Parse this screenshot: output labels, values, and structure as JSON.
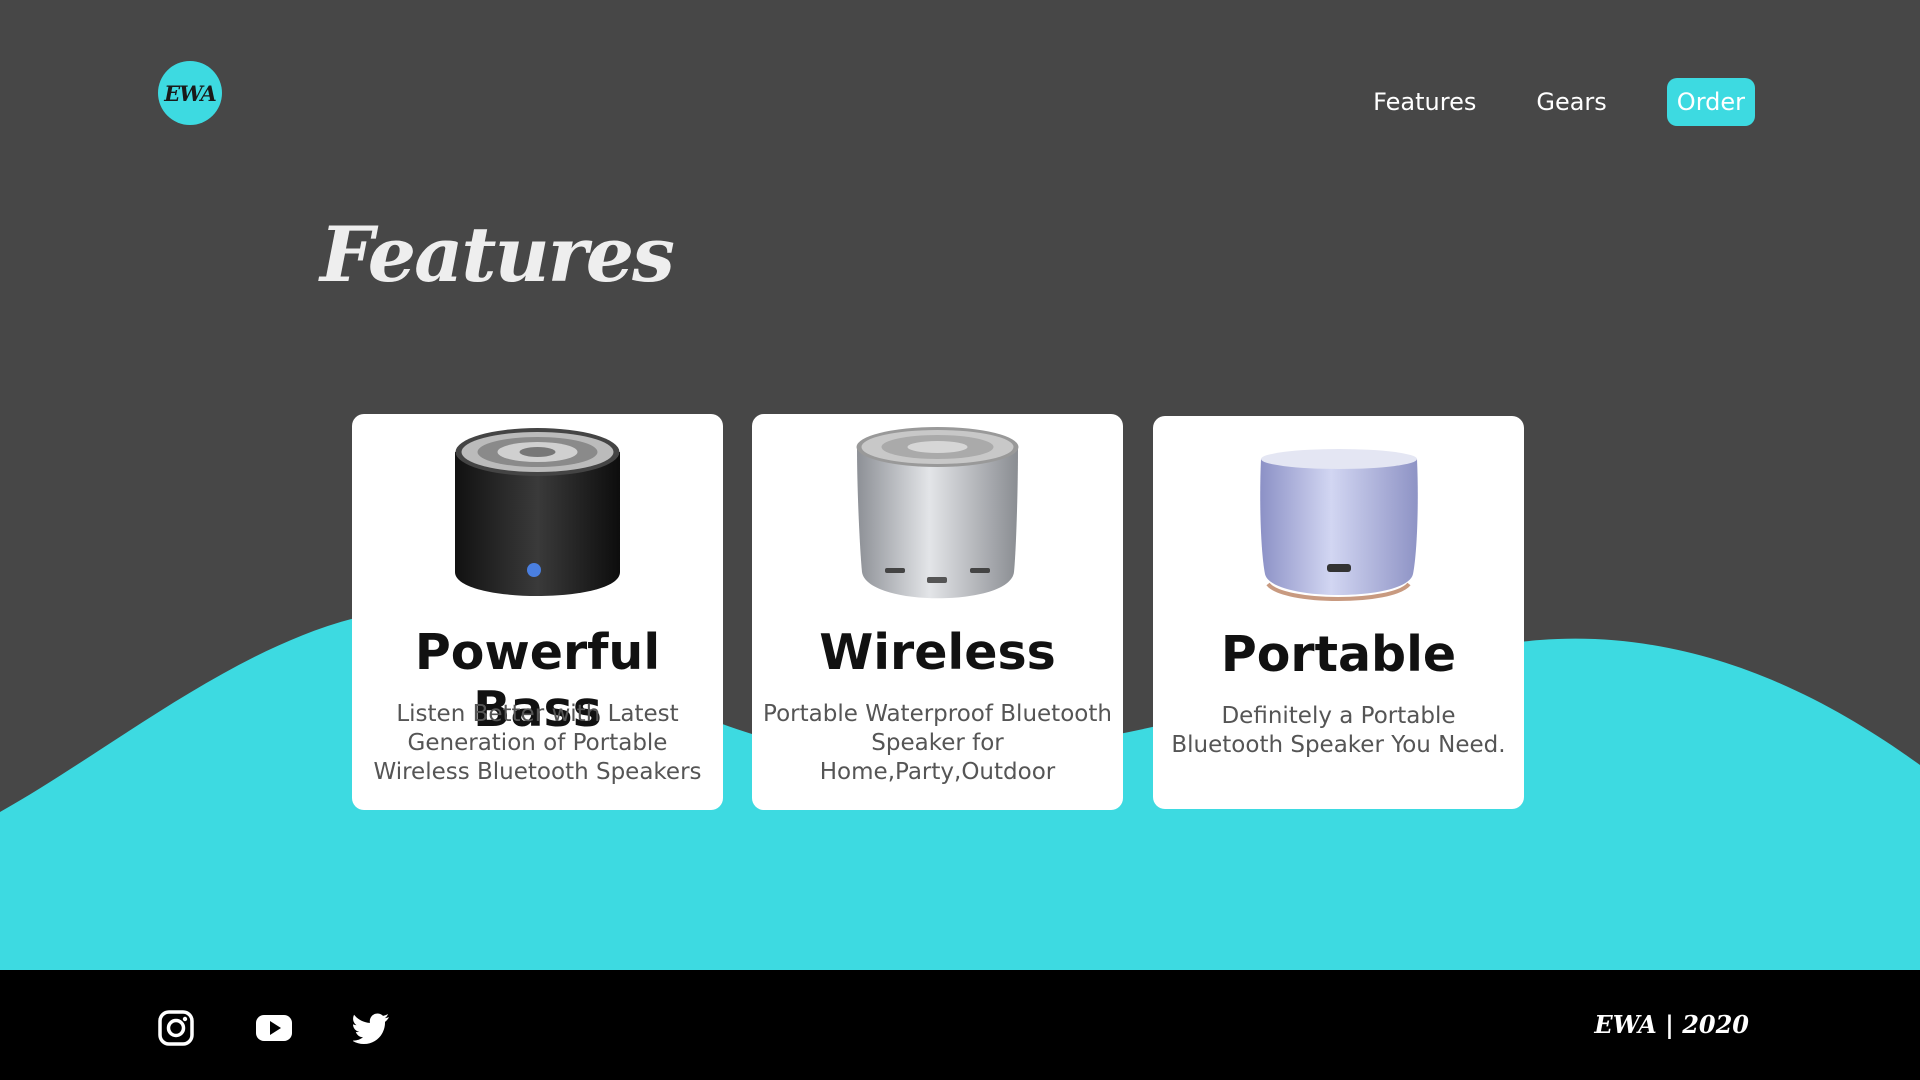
{
  "header": {
    "logo_text": "EWA",
    "nav": {
      "features": "Features",
      "gears": "Gears",
      "order": "Order"
    }
  },
  "main": {
    "title": "Features",
    "cards": [
      {
        "title": "Powerful Bass",
        "description": "Listen Better with Latest Generation of Portable Wireless Bluetooth Speakers",
        "image": "black-speaker"
      },
      {
        "title": "Wireless",
        "description": "Portable Waterproof Bluetooth Speaker for Home,Party,Outdoor",
        "image": "silver-speaker"
      },
      {
        "title": "Portable",
        "description": "Definitely a Portable Bluetooth Speaker You Need.",
        "image": "lavender-speaker"
      }
    ]
  },
  "footer": {
    "social": [
      "instagram-icon",
      "youtube-icon",
      "twitter-icon"
    ],
    "copyright": "EWA | 2020"
  },
  "colors": {
    "background": "#474747",
    "accent": "#3ddae1",
    "footer": "#000000",
    "card": "#ffffff"
  }
}
